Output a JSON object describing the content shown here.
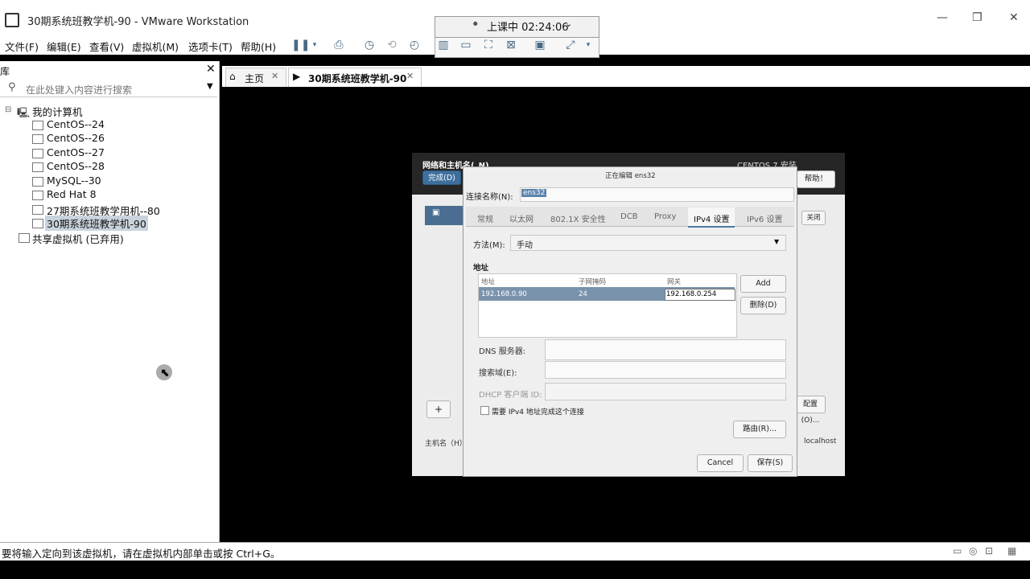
{
  "window": {
    "title": "30期系统班教学机-90 - VMware Workstation"
  },
  "menu": {
    "items": [
      "文件(F)",
      "编辑(E)",
      "查看(V)",
      "虚拟机(M)",
      "选项卡(T)",
      "帮助(H)"
    ]
  },
  "timer": {
    "text": "上课中 02:24:06"
  },
  "library": {
    "title": "库",
    "search_placeholder": "在此处键入内容进行搜索",
    "root": "我的计算机",
    "vms": [
      "CentOS--24",
      "CentOS--26",
      "CentOS--27",
      "CentOS--28",
      "MySQL--30",
      "Red Hat 8",
      "27期系统班教学用机--80",
      "30期系统班教学机-90"
    ],
    "shared": "共享虚拟机 (已弃用)"
  },
  "tabs": [
    {
      "label": "主页"
    },
    {
      "label": "30期系统班教学机-90"
    }
  ],
  "status": {
    "text": "要将输入定向到该虚拟机，请在虚拟机内部单击或按 Ctrl+G。"
  },
  "installer": {
    "header_left": "网络和主机名(_N)",
    "header_right": "CENTOS 7 安装",
    "done": "完成(D)",
    "help": "帮助！",
    "close": "关闭",
    "config_btn": "配置(O)...",
    "add": "+",
    "hostname_label": "主机名（H）",
    "hostname_value": "localhost"
  },
  "dialog": {
    "title": "正在编辑 ens32",
    "conn_name_label": "连接名称(N):",
    "conn_name_value": "ens32",
    "tabs": [
      "常规",
      "以太网",
      "802.1X 安全性",
      "DCB",
      "Proxy",
      "IPv4 设置",
      "IPv6 设置"
    ],
    "active_tab": "IPv4 设置",
    "method_label": "方法(M):",
    "method_value": "手动",
    "address_section": "地址",
    "cols": [
      "地址",
      "子网掩码",
      "网关"
    ],
    "row": {
      "address": "192.168.0.90",
      "mask": "24",
      "gateway": "192.168.0.254"
    },
    "add_btn": "Add",
    "delete_btn": "删除(D)",
    "dns_label": "DNS 服务器:",
    "search_label": "搜索域(E):",
    "dhcp_label": "DHCP 客户端 ID:",
    "require_ipv4": "需要 IPv4 地址完成这个连接",
    "routes_btn": "路由(R)...",
    "cancel_btn": "Cancel",
    "save_btn": "保存(S)"
  }
}
